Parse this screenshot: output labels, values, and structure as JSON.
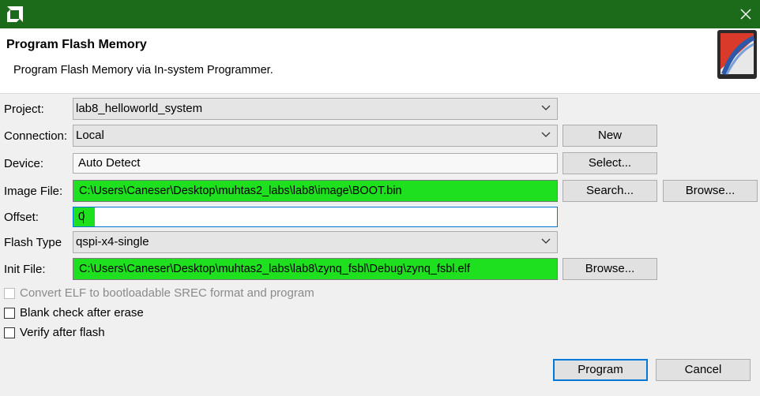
{
  "window": {
    "logo_icon": "amd-logo-icon",
    "close_icon": "close-icon",
    "titlebar_color": "#1b6b1b"
  },
  "header": {
    "title": "Program Flash Memory",
    "description": "Program Flash Memory via In-system Programmer.",
    "icon": "flash-programmer-icon"
  },
  "form": {
    "project": {
      "label": "Project:",
      "value": "lab8_helloworld_system"
    },
    "connection": {
      "label": "Connection:",
      "value": "Local",
      "new_label": "New"
    },
    "device": {
      "label": "Device:",
      "value": "Auto Detect",
      "select_label": "Select..."
    },
    "image_file": {
      "label": "Image File:",
      "value": "C:\\Users\\Caneser\\Desktop\\muhtas2_labs\\lab8\\image\\BOOT.bin",
      "search_label": "Search...",
      "browse_label": "Browse..."
    },
    "offset": {
      "label": "Offset:",
      "value": "0"
    },
    "flash_type": {
      "label": "Flash Type",
      "value": "qspi-x4-single"
    },
    "init_file": {
      "label": "Init File:",
      "value": "C:\\Users\\Caneser\\Desktop\\muhtas2_labs\\lab8\\zynq_fsbl\\Debug\\zynq_fsbl.elf",
      "browse_label": "Browse..."
    },
    "highlight_color": "#1ee01e"
  },
  "options": {
    "convert_elf": {
      "label": "Convert ELF to bootloadable SREC format and program",
      "checked": false,
      "enabled": false
    },
    "blank_check": {
      "label": "Blank check after erase",
      "checked": false,
      "enabled": true
    },
    "verify": {
      "label": "Verify after flash",
      "checked": false,
      "enabled": true
    }
  },
  "footer": {
    "program_label": "Program",
    "cancel_label": "Cancel"
  }
}
